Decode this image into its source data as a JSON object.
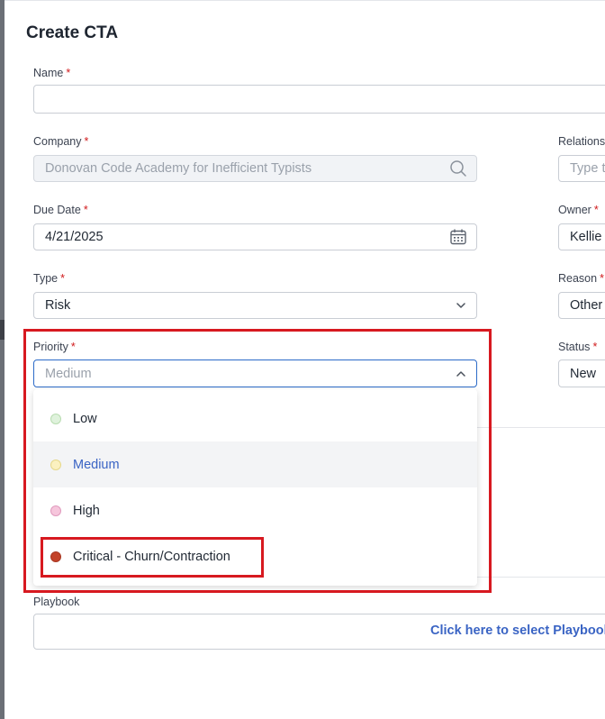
{
  "modal": {
    "title": "Create CTA"
  },
  "required_mark": "*",
  "fields": {
    "name": {
      "label": "Name",
      "value": ""
    },
    "company": {
      "label": "Company",
      "placeholder": "Donovan Code Academy for Inefficient Typists",
      "icon": "search-icon"
    },
    "relationship": {
      "label": "Relations",
      "placeholder": "Type t"
    },
    "due_date": {
      "label": "Due Date",
      "value": "4/21/2025",
      "icon": "calendar-icon"
    },
    "owner": {
      "label": "Owner",
      "value": "Kellie"
    },
    "type": {
      "label": "Type",
      "value": "Risk",
      "icon": "chevron-down-icon"
    },
    "reason": {
      "label": "Reason",
      "value": "Other"
    },
    "priority": {
      "label": "Priority",
      "value": "Medium",
      "icon": "chevron-up-icon"
    },
    "status": {
      "label": "Status",
      "value": "New"
    },
    "playbook": {
      "label": "Playbook",
      "link": "Click here to select Playbook"
    }
  },
  "priority_options": [
    {
      "label": "Low",
      "dot_fill": "#dff2dc",
      "dot_border": "#b8dcb0",
      "selected": false
    },
    {
      "label": "Medium",
      "dot_fill": "#fbf1c0",
      "dot_border": "#e6d88a",
      "selected": true
    },
    {
      "label": "High",
      "dot_fill": "#f6c6dc",
      "dot_border": "#e09abd",
      "selected": false
    },
    {
      "label": "Critical - Churn/Contraction",
      "dot_fill": "#c3432a",
      "dot_border": "#a83722",
      "selected": false
    }
  ],
  "colors": {
    "highlight": "#d71920",
    "accent": "#3a64c4",
    "focus_border": "#2c6bc8"
  }
}
